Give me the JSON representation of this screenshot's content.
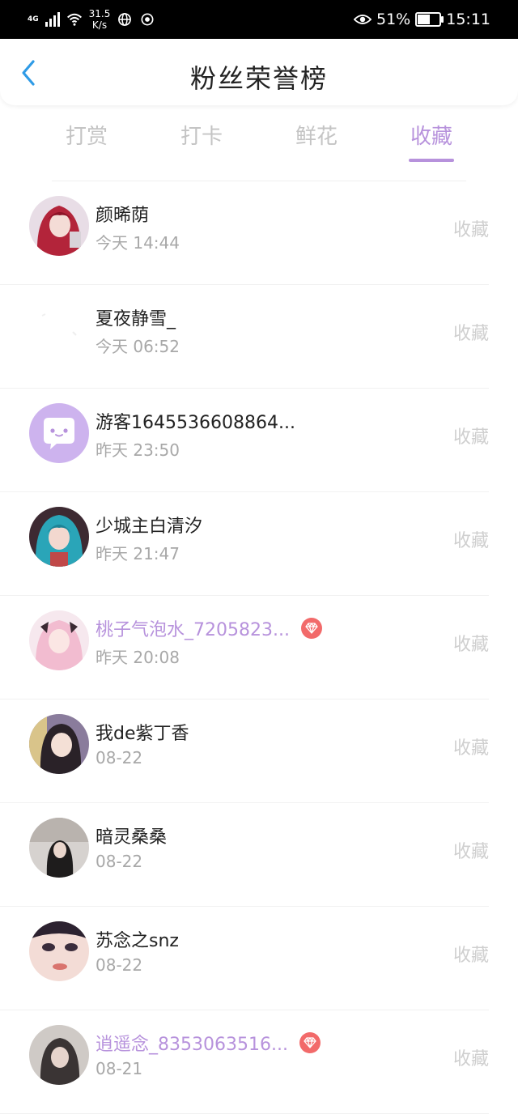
{
  "status_bar": {
    "network": "4G",
    "speed_value": "31.5",
    "speed_unit": "K/s",
    "battery_percent": "51%",
    "battery_level": 0.51,
    "time": "15:11"
  },
  "header": {
    "title": "粉丝荣誉榜"
  },
  "tabs": [
    {
      "label": "打赏",
      "active": false
    },
    {
      "label": "打卡",
      "active": false
    },
    {
      "label": "鲜花",
      "active": false
    },
    {
      "label": "收藏",
      "active": true
    }
  ],
  "colors": {
    "accent": "#b792dc",
    "badge": "#f26a6a"
  },
  "fans": [
    {
      "name": "颜晞荫",
      "time": "今天 14:44",
      "action": "收藏",
      "vip": false,
      "avatar": "avatar-red-hair"
    },
    {
      "name": "夏夜静雪_",
      "time": "今天 06:52",
      "action": "收藏",
      "vip": false,
      "avatar": "avatar-blank"
    },
    {
      "name": "游客1645536608864...",
      "time": "昨天 23:50",
      "action": "收藏",
      "vip": false,
      "avatar": "avatar-default-chat"
    },
    {
      "name": "少城主白清汐",
      "time": "昨天 21:47",
      "action": "收藏",
      "vip": false,
      "avatar": "avatar-blue-hair"
    },
    {
      "name": "桃子气泡水_7205823...",
      "time": "昨天 20:08",
      "action": "收藏",
      "vip": true,
      "avatar": "avatar-pink-hair"
    },
    {
      "name": "我de紫丁香",
      "time": "08-22",
      "action": "收藏",
      "vip": false,
      "avatar": "avatar-dark-hair"
    },
    {
      "name": "暗灵桑桑",
      "time": "08-22",
      "action": "收藏",
      "vip": false,
      "avatar": "avatar-photo-girl"
    },
    {
      "name": "苏念之snz",
      "time": "08-22",
      "action": "收藏",
      "vip": false,
      "avatar": "avatar-closeup-face"
    },
    {
      "name": "逍遥念_8353063516...",
      "time": "08-21",
      "action": "收藏",
      "vip": true,
      "avatar": "avatar-photo-dark"
    }
  ]
}
